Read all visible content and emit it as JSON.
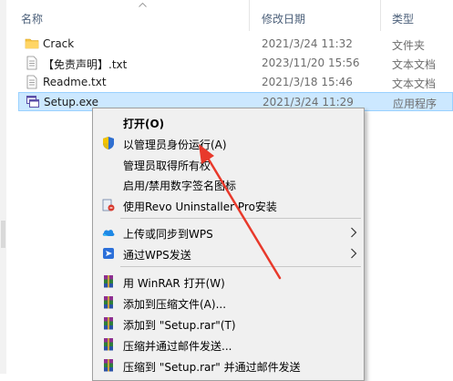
{
  "columns": {
    "name": "名称",
    "date": "修改日期",
    "type": "类型"
  },
  "files": [
    {
      "name": "Crack",
      "date": "2021/3/24 11:32",
      "type": "文件夹",
      "icon": "folder-icon"
    },
    {
      "name": "【免责声明】.txt",
      "date": "2023/11/20 15:56",
      "type": "文本文档",
      "icon": "text-file-icon"
    },
    {
      "name": "Readme.txt",
      "date": "2021/3/18 15:46",
      "type": "文本文档",
      "icon": "text-file-icon"
    },
    {
      "name": "Setup.exe",
      "date": "2021/3/24 11:29",
      "type": "应用程序",
      "icon": "exe-icon"
    }
  ],
  "context_menu": {
    "open": "打开(O)",
    "run_as_admin": "以管理员身份运行(A)",
    "take_ownership": "管理员取得所有权",
    "signature_icon": "启用/禁用数字签名图标",
    "revo": "使用Revo Uninstaller Pro安装",
    "wps_upload": "上传或同步到WPS",
    "wps_send": "通过WPS发送",
    "winrar_open": "用 WinRAR 打开(W)",
    "add_archive": "添加到压缩文件(A)...",
    "add_setup_rar": "添加到 \"Setup.rar\"(T)",
    "compress_email": "压缩并通过邮件发送...",
    "compress_setup_email": "压缩到 \"Setup.rar\" 并通过邮件发送"
  },
  "colors": {
    "selection": "#cce8ff",
    "menu_bg": "#f0f0f0",
    "arrow": "#e8392b"
  }
}
